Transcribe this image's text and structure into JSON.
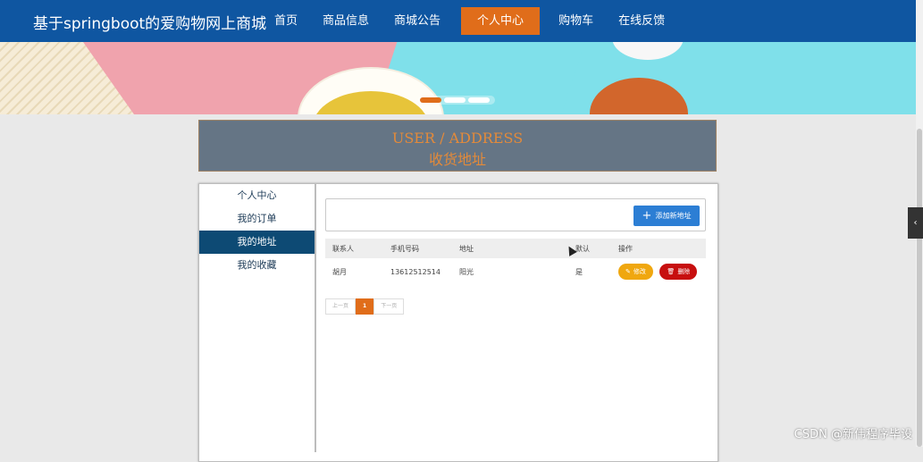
{
  "site": {
    "title": "基于springboot的爱购物网上商城"
  },
  "nav": {
    "items": [
      {
        "label": "首页"
      },
      {
        "label": "商品信息"
      },
      {
        "label": "商城公告"
      },
      {
        "label": "个人中心",
        "active": true
      },
      {
        "label": "购物车"
      },
      {
        "label": "在线反馈"
      }
    ]
  },
  "banner": {
    "active_slide": 1,
    "slide_count": 3
  },
  "section": {
    "title_en": "USER / ADDRESS",
    "title_zh": "收货地址"
  },
  "sidebar": {
    "items": [
      {
        "label": "个人中心"
      },
      {
        "label": "我的订单"
      },
      {
        "label": "我的地址",
        "active": true
      },
      {
        "label": "我的收藏"
      }
    ]
  },
  "toolbar": {
    "add_label": "添加新地址"
  },
  "table": {
    "headers": [
      "联系人",
      "手机号码",
      "地址",
      "默认",
      "操作"
    ],
    "rows": [
      {
        "contact": "胡月",
        "phone": "13612512514",
        "address": "阳光",
        "default": "是",
        "edit_label": "修改",
        "delete_label": "删除"
      }
    ]
  },
  "pagination": {
    "prev": "上一页",
    "current": "1",
    "next": "下一页"
  },
  "side_tab": {
    "icon": "chevron-left-icon",
    "glyph": "‹"
  },
  "watermark": "CSDN @新伟程序毕设"
}
